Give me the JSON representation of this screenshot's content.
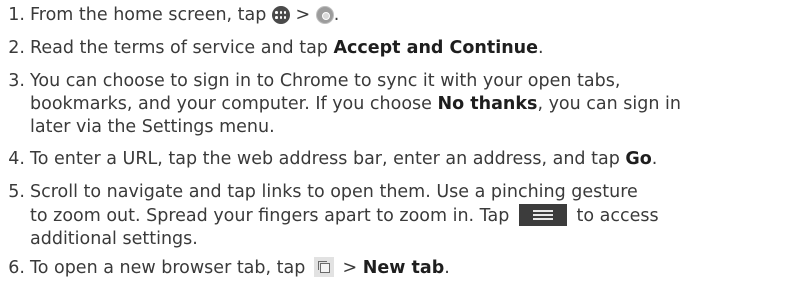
{
  "steps": [
    {
      "number": "1.",
      "text_before": "From the home screen, tap",
      "separator": ">",
      "text_end": ".",
      "icons": [
        "apps-icon",
        "chrome-icon"
      ]
    },
    {
      "number": "2.",
      "text_before": "Read the terms of service and tap",
      "bold": "Accept and Continue",
      "text_end": "."
    },
    {
      "number": "3.",
      "line1": "You can choose to sign in to Chrome to sync it with your open tabs,",
      "line2_before": "bookmarks, and your computer. If you choose",
      "bold": "No thanks",
      "line2_after": ", you can sign in",
      "line3": "later via the Settings menu."
    },
    {
      "number": "4.",
      "text_before": "To enter a URL, tap the web address bar, enter an address, and tap",
      "bold": "Go",
      "text_end": "."
    },
    {
      "number": "5.",
      "line1": "Scroll to navigate and tap links to open them. Use a pinching gesture",
      "line2_before": "to zoom out. Spread your fingers apart to zoom in. Tap",
      "line2_after": "to access",
      "line3": "additional settings.",
      "icons": [
        "menu-icon"
      ]
    },
    {
      "number": "6.",
      "text_before": "To open a new browser tab, tap",
      "separator": ">",
      "bold": "New tab",
      "text_end": ".",
      "icons": [
        "tabs-icon"
      ]
    }
  ]
}
